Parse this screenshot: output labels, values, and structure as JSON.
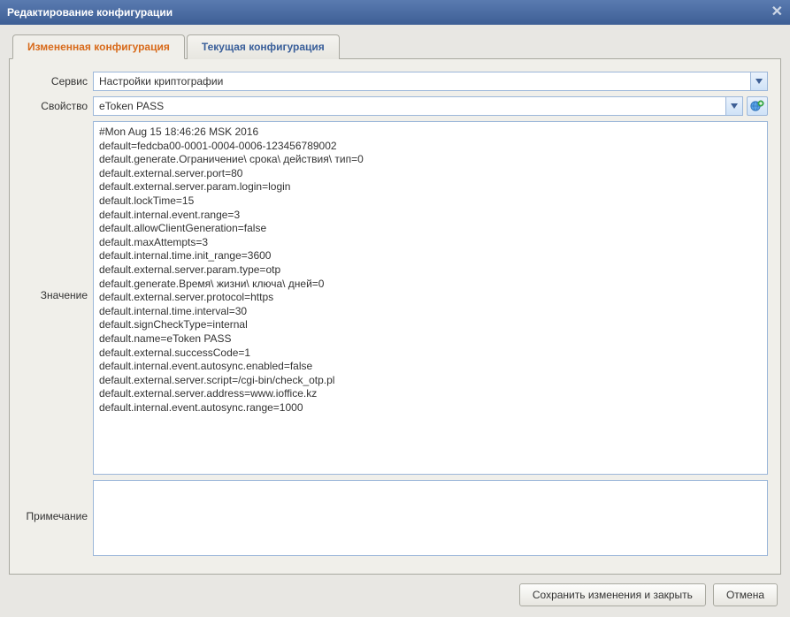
{
  "window": {
    "title": "Редактирование конфигурации"
  },
  "tabs": {
    "changed": "Измененная конфигурация",
    "current": "Текущая конфигурация"
  },
  "labels": {
    "service": "Сервис",
    "property": "Свойство",
    "value": "Значение",
    "note": "Примечание"
  },
  "fields": {
    "service": "Настройки криптографии",
    "property": "eToken PASS",
    "value": "#Mon Aug 15 18:46:26 MSK 2016\ndefault=fedcba00-0001-0004-0006-123456789002\ndefault.generate.Ограничение\\ срока\\ действия\\ тип=0\ndefault.external.server.port=80\ndefault.external.server.param.login=login\ndefault.lockTime=15\ndefault.internal.event.range=3\ndefault.allowClientGeneration=false\ndefault.maxAttempts=3\ndefault.internal.time.init_range=3600\ndefault.external.server.param.type=otp\ndefault.generate.Время\\ жизни\\ ключа\\ дней=0\ndefault.external.server.protocol=https\ndefault.internal.time.interval=30\ndefault.signCheckType=internal\ndefault.name=eToken PASS\ndefault.external.successCode=1\ndefault.internal.event.autosync.enabled=false\ndefault.external.server.script=/cgi-bin/check_otp.pl\ndefault.external.server.address=www.ioffice.kz\ndefault.internal.event.autosync.range=1000",
    "note": ""
  },
  "buttons": {
    "save": "Сохранить изменения и закрыть",
    "cancel": "Отмена"
  }
}
